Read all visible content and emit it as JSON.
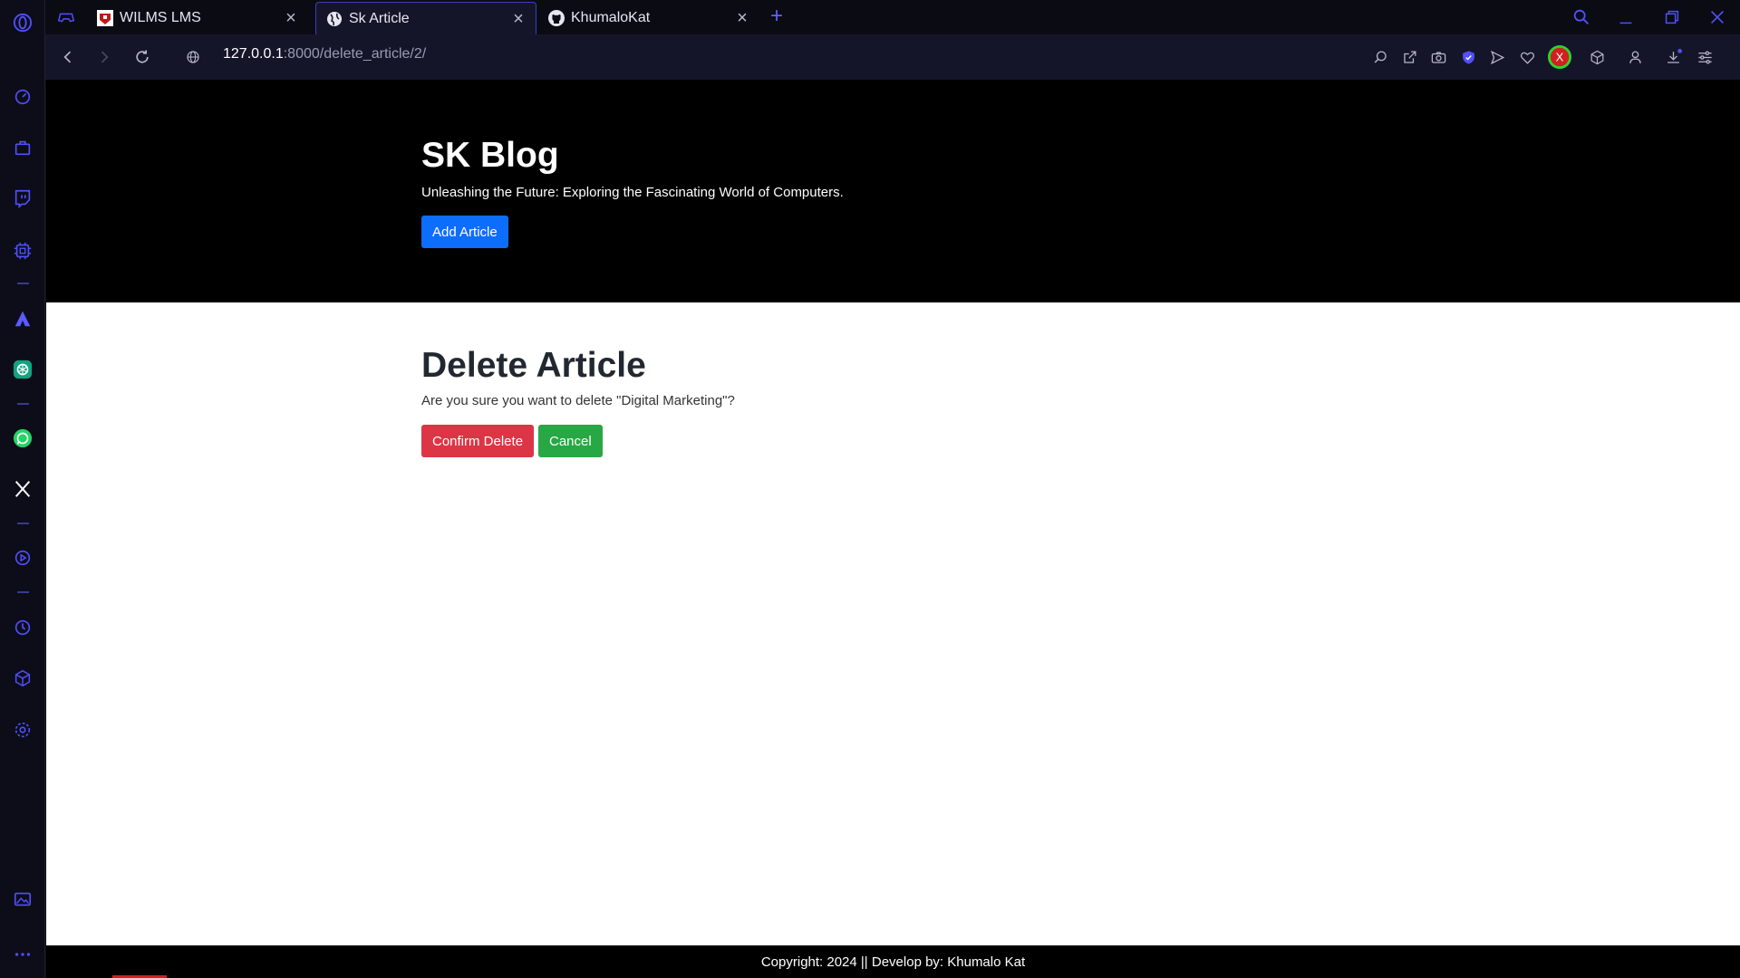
{
  "browser": {
    "tabs": [
      {
        "title": "WILMS LMS",
        "icon": "wilms-favicon"
      },
      {
        "title": "Sk Article",
        "icon": "globe-icon"
      },
      {
        "title": "KhumaloKat",
        "icon": "github-icon"
      }
    ],
    "active_tab": 1,
    "new_tab_label": "+",
    "url": {
      "host": "127.0.0.1",
      "path": ":8000/delete_article/2/"
    },
    "toolbar_icons": [
      "search-in-page-icon",
      "share-icon",
      "snapshot-icon",
      "vpn-shield-icon",
      "send-icon",
      "heart-icon",
      "extension-x-icon",
      "cube-icon",
      "account-icon",
      "download-icon",
      "easy-setup-icon"
    ],
    "extension_x_label": "X",
    "colors": {
      "accent": "#5050ff",
      "tab_border": "#3c3cc8",
      "chrome_bg": "#15152a"
    }
  },
  "sidebar": {
    "icons": [
      "opera-logo-icon",
      "speed-dial-icon",
      "shopping-bag-icon",
      "twitch-icon",
      "ai-chip-icon",
      "aria-icon",
      "chatgpt-icon",
      "whatsapp-icon",
      "x-twitter-icon",
      "player-icon",
      "history-icon",
      "cube-icon",
      "settings-icon",
      "gallery-icon",
      "more-icon"
    ]
  },
  "page": {
    "hero": {
      "title": "SK Blog",
      "subtitle": "Unleashing the Future: Exploring the Fascinating World of Computers.",
      "add_button": "Add Article"
    },
    "heading": "Delete Article",
    "confirm_text": "Are you sure you want to delete \"Digital Marketing\"?",
    "confirm_button": "Confirm Delete",
    "cancel_button": "Cancel",
    "footer": "Copyright: 2024 || Develop by: Khumalo Kat",
    "colors": {
      "primary": "#0d6efd",
      "danger": "#dc3545",
      "success": "#28a745",
      "hero_bg": "#000000"
    }
  }
}
